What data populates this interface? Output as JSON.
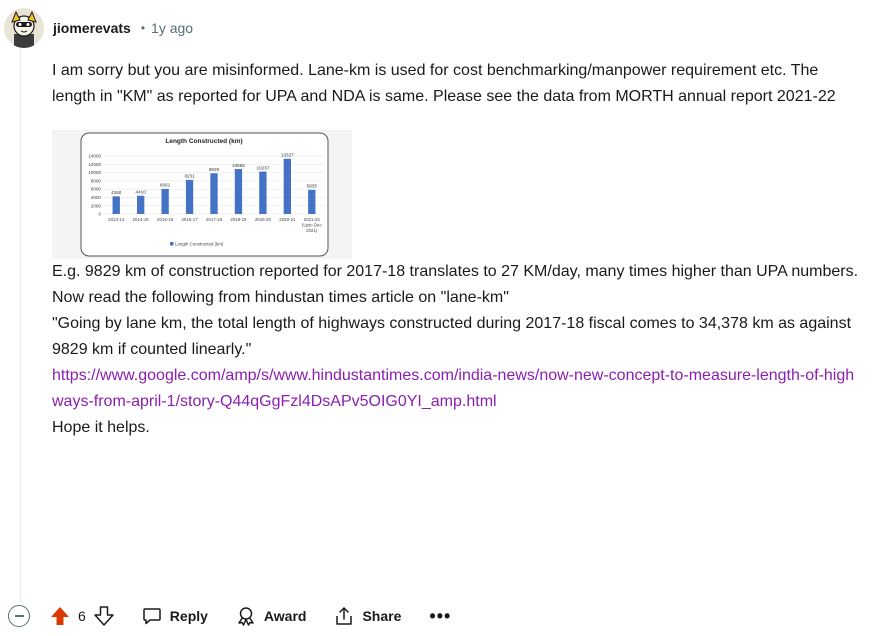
{
  "comment": {
    "username": "jiomerevats",
    "separator": "•",
    "time": "1y ago",
    "paragraphs": {
      "p1": "I am sorry but you are misinformed. Lane-km is used for cost benchmarking/manpower requirement etc. The length in \"KM\" as reported for UPA and NDA is same. Please see the data from MORTH annual report 2021-22",
      "p2": "E.g. 9829 km of construction reported for 2017-18 translates to 27 KM/day, many times higher than UPA numbers.",
      "p3": "Now read the following from hindustan times article on \"lane-km\"",
      "p4": "\"Going by lane km, the total length of highways constructed during 2017-18 fiscal comes to 34,378 km as against 9829 km if counted linearly.\"",
      "link": "https://www.google.com/amp/s/www.hindustantimes.com/india-news/now-new-concept-to-measure-length-of-highways-from-april-1/story-Q44qGgFzl4DsAPv5OIG0YI_amp.html",
      "p6": "Hope it helps."
    }
  },
  "actions": {
    "vote_count": "6",
    "reply_label": "Reply",
    "award_label": "Award",
    "share_label": "Share",
    "more_label": "•••"
  },
  "icons": {
    "upvote": "upvote-arrow-icon",
    "downvote": "downvote-arrow-icon",
    "reply": "speech-bubble-icon",
    "award": "award-ribbon-icon",
    "share": "share-upload-icon",
    "collapse": "collapse-minus-icon"
  },
  "colors": {
    "upvote_active": "#d93a00",
    "link": "#8b1fb0",
    "meta": "#576f76",
    "bar": "#4472c4"
  },
  "chart_data": {
    "type": "bar",
    "title": "Length Constructed (km)",
    "categories": [
      "2013-14",
      "2014-15",
      "2015-16",
      "2016-17",
      "2017-18",
      "2018-19",
      "2019-20",
      "2020-21",
      "2021-22 (Upto Dec 2021)"
    ],
    "category_lines": [
      [
        "2013-14"
      ],
      [
        "2014-15"
      ],
      [
        "2015-16"
      ],
      [
        "2016-17"
      ],
      [
        "2017-18"
      ],
      [
        "2018-19"
      ],
      [
        "2019-20"
      ],
      [
        "2020-21"
      ],
      [
        "2021-22",
        "(Upto Dec",
        "2021)"
      ]
    ],
    "series": [
      {
        "name": "Length Constructed (km)",
        "values": [
          4260,
          4410,
          6061,
          8231,
          9829,
          10855,
          10237,
          13327,
          5835
        ]
      }
    ],
    "yticks": [
      "14000",
      "12000",
      "10000",
      "8000",
      "6000",
      "4000",
      "2000",
      "0"
    ],
    "ylim": [
      0,
      14000
    ],
    "legend": "bottom",
    "grid": true
  }
}
